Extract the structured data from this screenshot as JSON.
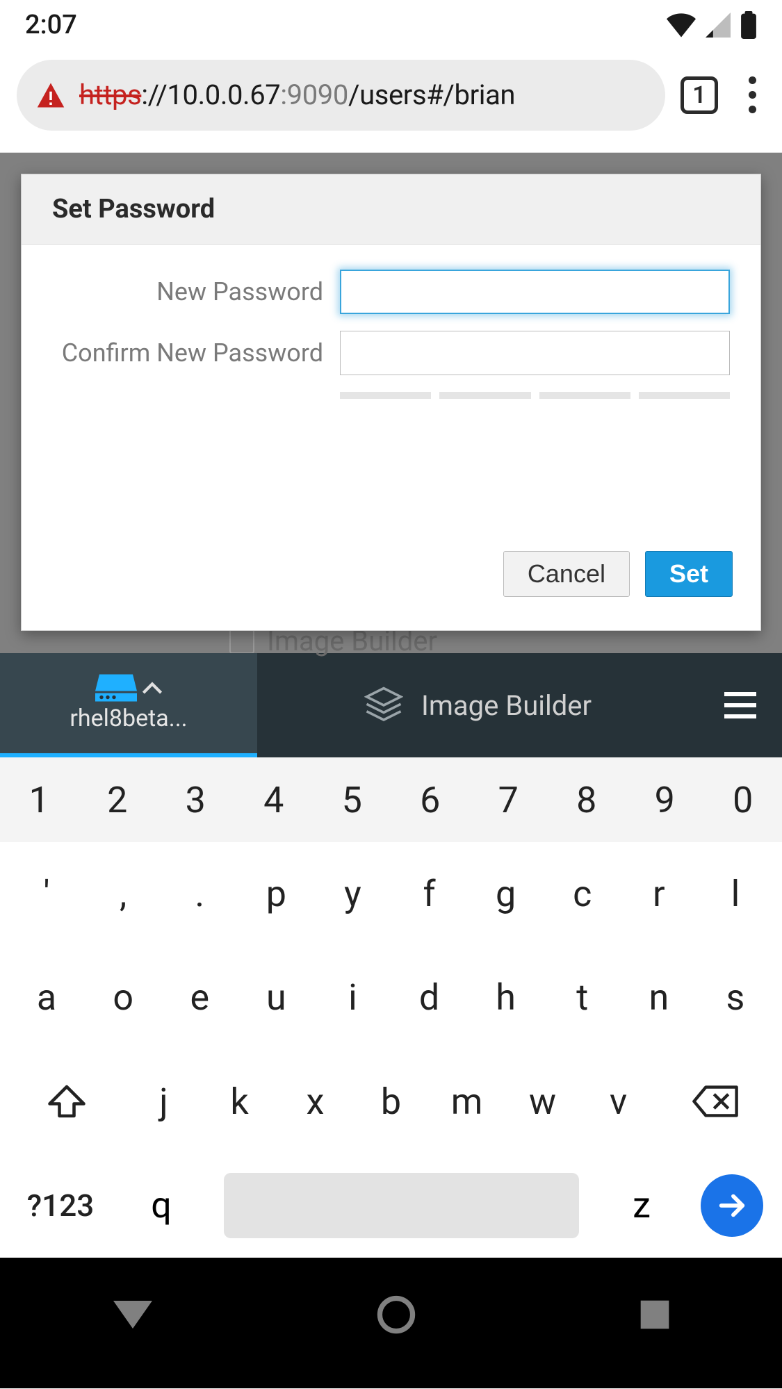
{
  "status": {
    "time": "2:07"
  },
  "browser": {
    "scheme": "https",
    "url_host": "://10.0.0.67",
    "url_port": ":9090",
    "url_path": "/users#/brian",
    "tab_count": "1"
  },
  "modal": {
    "title": "Set Password",
    "new_label": "New Password",
    "confirm_label": "Confirm New Password",
    "cancel": "Cancel",
    "set": "Set"
  },
  "page_bg": {
    "option": "Image Builder"
  },
  "kbbar": {
    "active_tab": "rhel8beta...",
    "builder": "Image Builder"
  },
  "keyboard": {
    "nums": [
      "1",
      "2",
      "3",
      "4",
      "5",
      "6",
      "7",
      "8",
      "9",
      "0"
    ],
    "row1": [
      "'",
      ",",
      ".",
      "p",
      "y",
      "f",
      "g",
      "c",
      "r",
      "l"
    ],
    "row2": [
      "a",
      "o",
      "e",
      "u",
      "i",
      "d",
      "h",
      "t",
      "n",
      "s"
    ],
    "row3": [
      "j",
      "k",
      "x",
      "b",
      "m",
      "w",
      "v"
    ],
    "sym": "?123",
    "q": "q",
    "z": "z"
  }
}
